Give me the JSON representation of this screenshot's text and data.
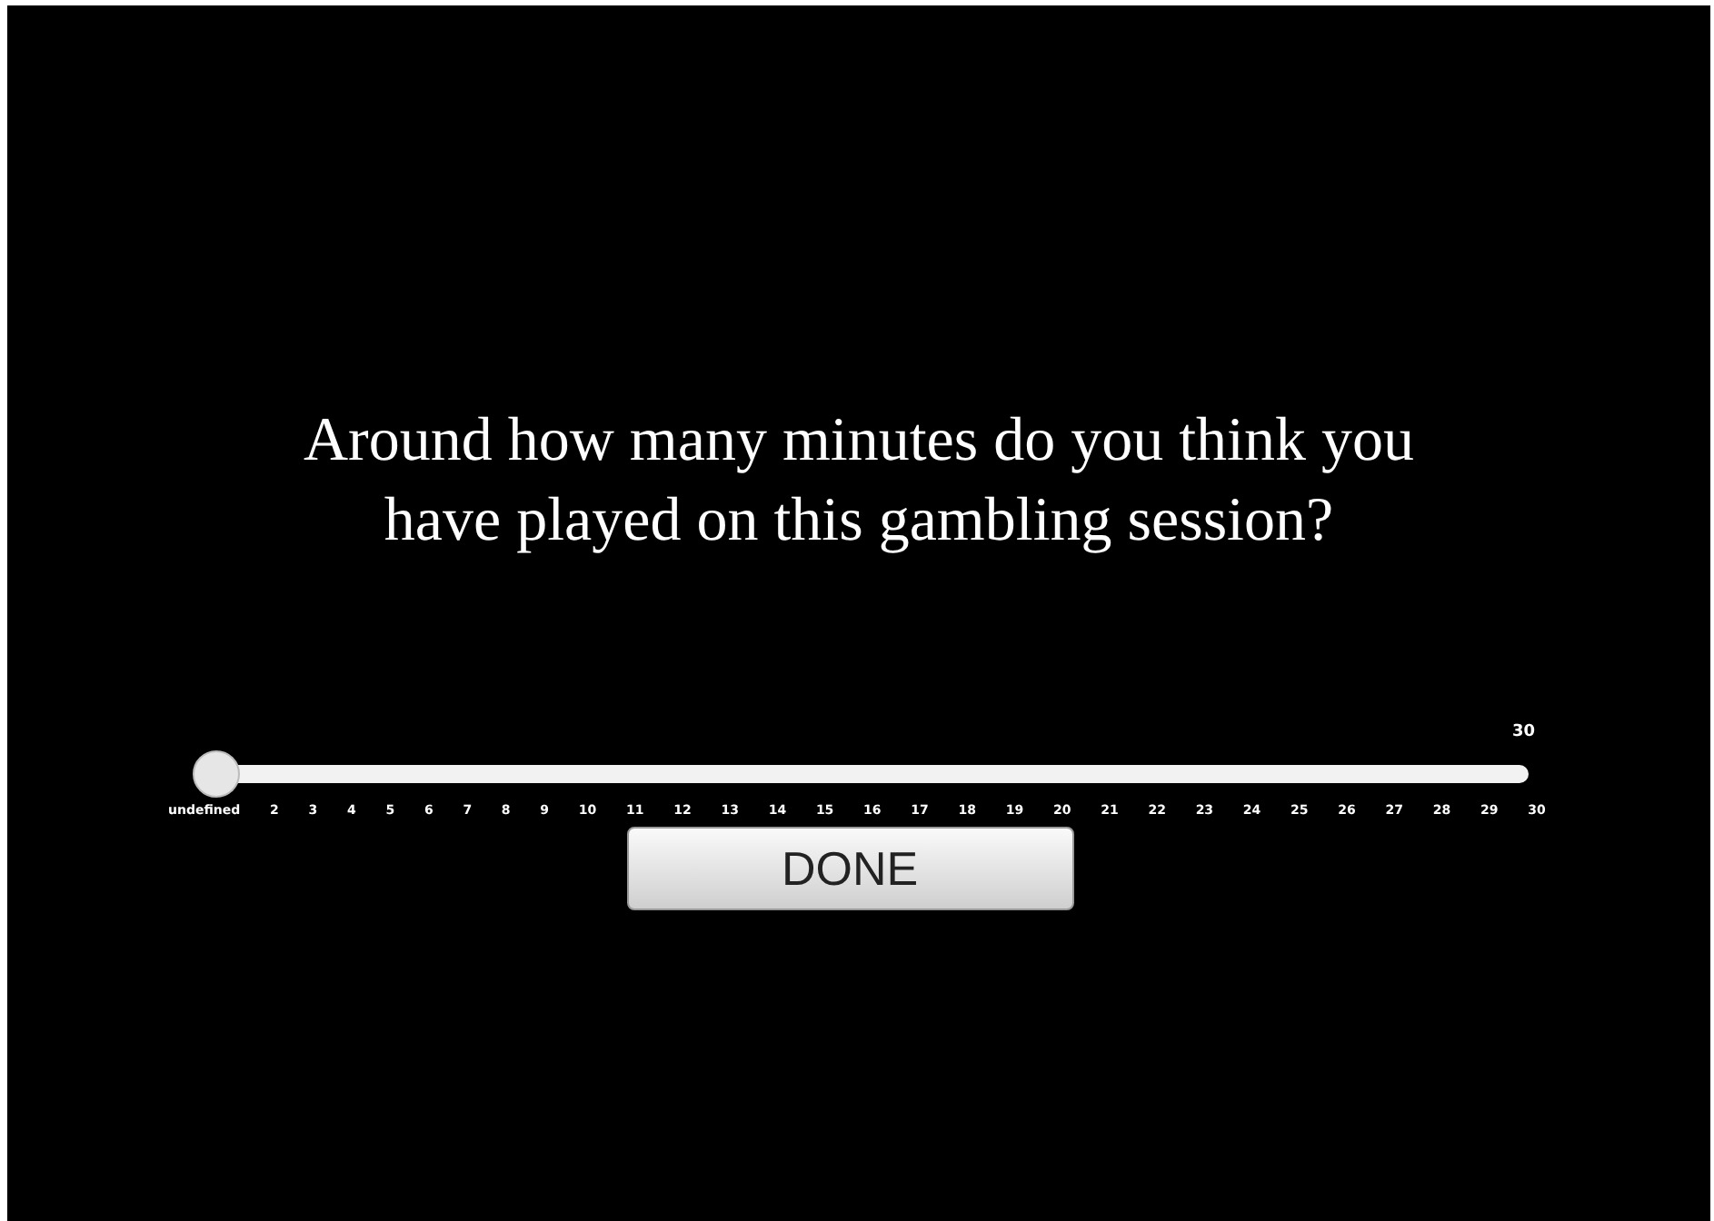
{
  "question": "Around how many minutes do you think you have played on this gambling session?",
  "slider": {
    "level": 0,
    "reading": "30",
    "ticks": [
      "undefined",
      "2",
      "3",
      "4",
      "5",
      "6",
      "7",
      "8",
      "9",
      "10",
      "11",
      "12",
      "13",
      "14",
      "15",
      "16",
      "17",
      "18",
      "19",
      "20",
      "21",
      "22",
      "23",
      "24",
      "25",
      "26",
      "27",
      "28",
      "29",
      "30"
    ]
  },
  "button": {
    "label": "DONE"
  }
}
